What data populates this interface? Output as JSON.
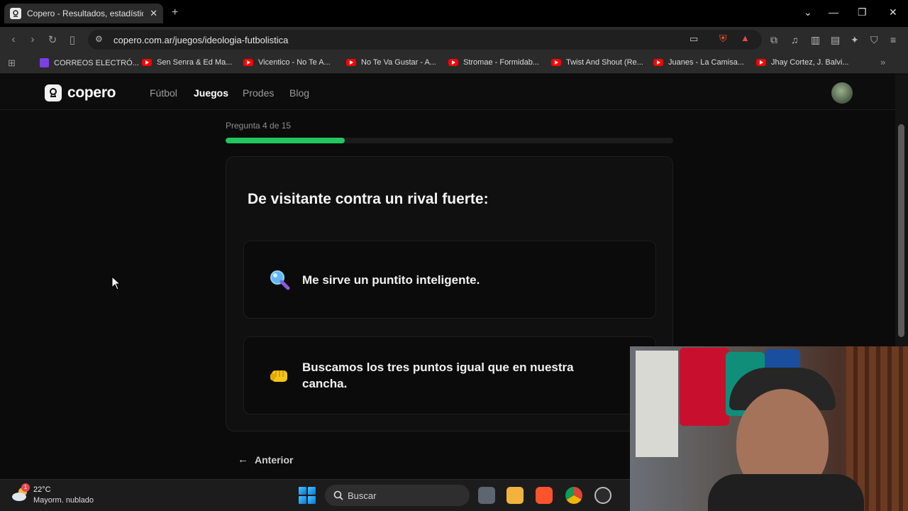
{
  "browser": {
    "tab_title": "Copero - Resultados, estadísticas",
    "tab_close": "✕",
    "new_tab": "+",
    "url": "copero.com.ar/juegos/ideologia-futbolistica",
    "bookmarks": [
      {
        "label": "CORREOS ELECTRÓ...",
        "icon": "mail-icon"
      },
      {
        "label": "Sen Senra & Ed Ma...",
        "icon": "youtube-icon"
      },
      {
        "label": "Vicentico - No Te A...",
        "icon": "youtube-icon"
      },
      {
        "label": "No Te Va Gustar - A...",
        "icon": "youtube-icon"
      },
      {
        "label": "Stromae - Formidab...",
        "icon": "youtube-icon"
      },
      {
        "label": "Twist And Shout (Re...",
        "icon": "youtube-icon"
      },
      {
        "label": "Juanes - La Camisa...",
        "icon": "youtube-icon"
      },
      {
        "label": "Jhay Cortez, J. Balvi...",
        "icon": "youtube-icon"
      }
    ]
  },
  "site": {
    "logo_text": "copero",
    "nav": [
      "Fútbol",
      "Juegos",
      "Prodes",
      "Blog"
    ],
    "active_nav": "Juegos"
  },
  "quiz": {
    "counter": "Pregunta 4 de 15",
    "progress_fraction": 0.267,
    "question": "De visitante contra un rival fuerte:",
    "options": [
      {
        "icon": "magnifier-icon",
        "label": "Me sirve un puntito inteligente."
      },
      {
        "icon": "fist-icon",
        "label": "Buscamos los tres puntos igual que en nuestra cancha."
      }
    ],
    "back_label": "Anterior",
    "accent_color": "#22c55e"
  },
  "taskbar": {
    "weather_badge": "1",
    "temperature": "22°C",
    "condition": "Mayorm. nublado",
    "search_placeholder": "Buscar"
  }
}
